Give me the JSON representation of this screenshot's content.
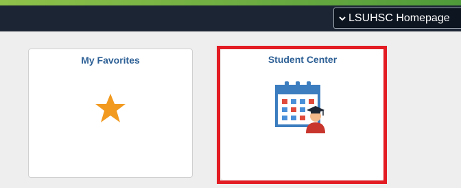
{
  "header": {
    "homepage_selector": {
      "label": "LSUHSC Homepage",
      "icon": "chevron-down-icon"
    }
  },
  "tiles": [
    {
      "title": "My Favorites",
      "icon": "star-icon",
      "icon_color": "#f29a1f"
    },
    {
      "title": "Student Center",
      "icon": "student-calendar-icon",
      "highlighted": true,
      "highlight_color": "#e31b23"
    }
  ],
  "colors": {
    "accent_green": "#8fc24a",
    "header_bg": "#1b2533",
    "tile_title": "#2c5f95"
  }
}
